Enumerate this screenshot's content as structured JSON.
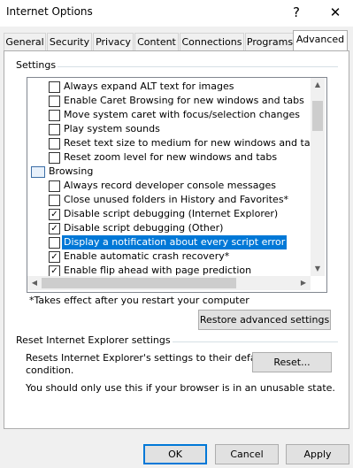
{
  "window": {
    "title": "Internet Options",
    "help_glyph": "?",
    "close_glyph": "✕"
  },
  "tabs": [
    {
      "label": "General"
    },
    {
      "label": "Security"
    },
    {
      "label": "Privacy"
    },
    {
      "label": "Content"
    },
    {
      "label": "Connections"
    },
    {
      "label": "Programs"
    },
    {
      "label": "Advanced"
    }
  ],
  "settings": {
    "group_label": "Settings",
    "items": [
      {
        "label": "Always expand ALT text for images",
        "checked": false
      },
      {
        "label": "Enable Caret Browsing for new windows and tabs",
        "checked": false
      },
      {
        "label": "Move system caret with focus/selection changes",
        "checked": false
      },
      {
        "label": "Play system sounds",
        "checked": false
      },
      {
        "label": "Reset text size to medium for new windows and tabs",
        "checked": false
      },
      {
        "label": "Reset zoom level for new windows and tabs",
        "checked": false
      },
      {
        "label": "Browsing",
        "category": true
      },
      {
        "label": "Always record developer console messages",
        "checked": false
      },
      {
        "label": "Close unused folders in History and Favorites*",
        "checked": false
      },
      {
        "label": "Disable script debugging (Internet Explorer)",
        "checked": true
      },
      {
        "label": "Disable script debugging (Other)",
        "checked": true
      },
      {
        "label": "Display a notification about every script error",
        "checked": false,
        "selected": true
      },
      {
        "label": "Enable automatic crash recovery*",
        "checked": true
      },
      {
        "label": "Enable flip ahead with page prediction",
        "checked": true
      }
    ],
    "check_glyph": "✓",
    "note": "*Takes effect after you restart your computer",
    "restore_button": "Restore advanced settings"
  },
  "reset": {
    "group_label": "Reset Internet Explorer settings",
    "description_line1": "Resets Internet Explorer's settings to their default",
    "description_line2": "condition.",
    "button": "Reset...",
    "warning": "You should only use this if your browser is in an unusable state."
  },
  "footer": {
    "ok": "OK",
    "cancel": "Cancel",
    "apply": "Apply"
  }
}
